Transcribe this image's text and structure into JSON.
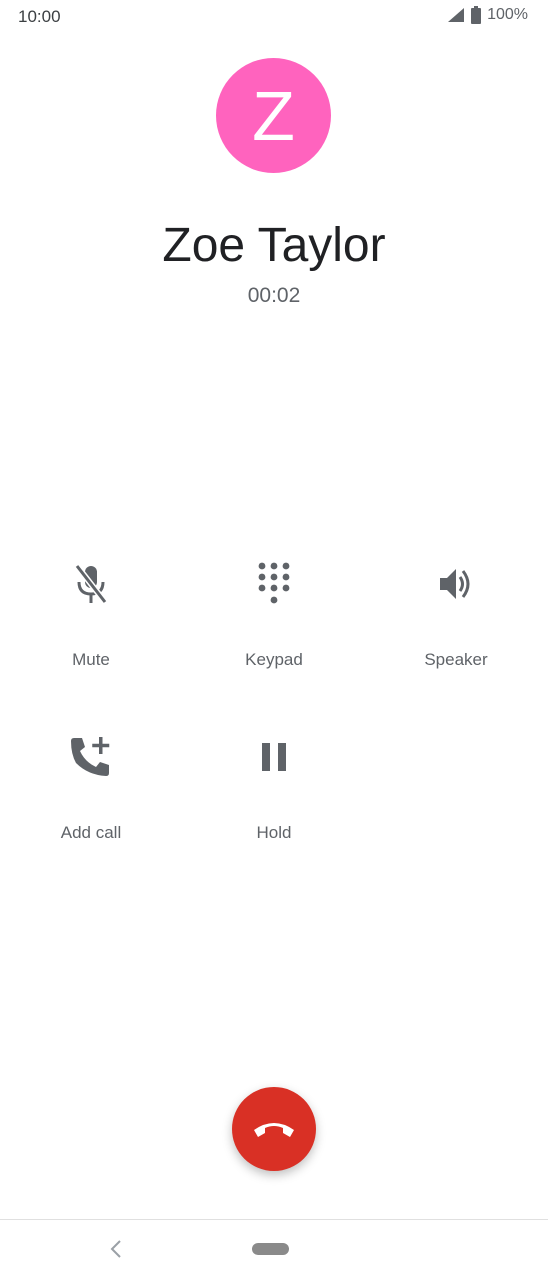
{
  "status_bar": {
    "time": "10:00",
    "battery": "100%",
    "signal_icon": "cellular-signal-icon",
    "battery_icon": "battery-icon"
  },
  "call": {
    "avatar_letter": "Z",
    "avatar_color": "#ff63be",
    "caller_name": "Zoe Taylor",
    "timer": "00:02"
  },
  "actions": [
    {
      "id": "mute",
      "label": "Mute",
      "icon": "mic-off-icon"
    },
    {
      "id": "keypad",
      "label": "Keypad",
      "icon": "dialpad-icon"
    },
    {
      "id": "speaker",
      "label": "Speaker",
      "icon": "speaker-icon"
    },
    {
      "id": "add_call",
      "label": "Add call",
      "icon": "add-call-icon"
    },
    {
      "id": "hold",
      "label": "Hold",
      "icon": "pause-icon"
    }
  ],
  "end_call": {
    "icon": "end-call-icon",
    "color": "#d93025"
  },
  "nav": {
    "back_icon": "back-chevron-icon",
    "home_icon": "home-pill-icon"
  }
}
